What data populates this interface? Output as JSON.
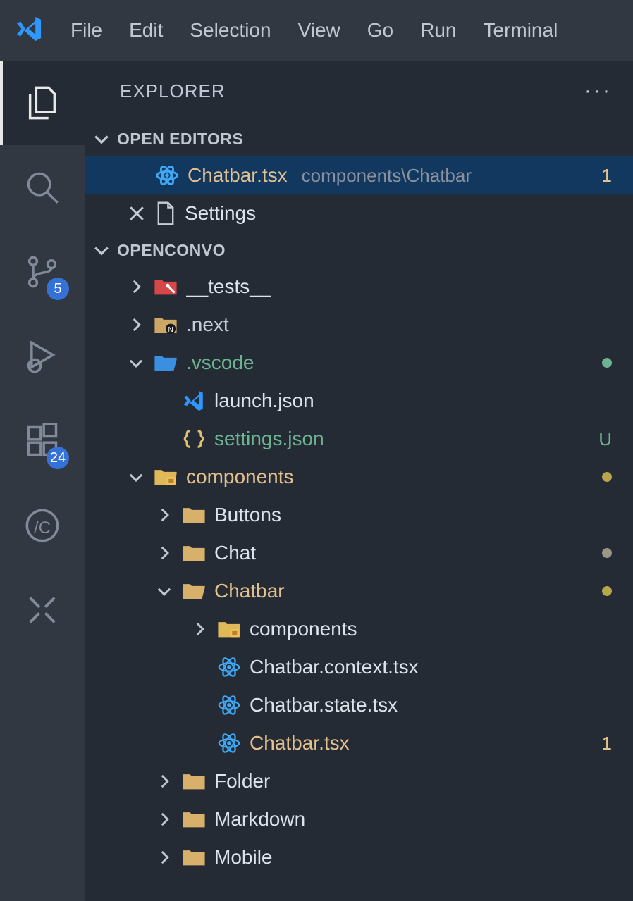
{
  "menubar": {
    "items": [
      "File",
      "Edit",
      "Selection",
      "View",
      "Go",
      "Run",
      "Terminal"
    ]
  },
  "activitybar": {
    "items": [
      {
        "name": "explorer",
        "badge": null,
        "active": true
      },
      {
        "name": "search",
        "badge": null,
        "active": false
      },
      {
        "name": "source-control",
        "badge": "5",
        "active": false
      },
      {
        "name": "run-debug",
        "badge": null,
        "active": false
      },
      {
        "name": "extensions",
        "badge": "24",
        "active": false
      },
      {
        "name": "codeium",
        "badge": null,
        "active": false
      },
      {
        "name": "copilot",
        "badge": null,
        "active": false
      }
    ]
  },
  "sidebar": {
    "title": "EXPLORER",
    "sections": {
      "open_editors": {
        "title": "OPEN EDITORS",
        "items": [
          {
            "name": "Chatbar.tsx",
            "path": "components\\Chatbar",
            "modified": true,
            "problems": "1",
            "icon": "react"
          },
          {
            "name": "Settings",
            "path": "",
            "modified": false,
            "icon": "file",
            "close": true
          }
        ]
      },
      "workspace": {
        "title": "OPENCONVO",
        "tree": [
          {
            "depth": 1,
            "type": "folder-red",
            "name": "__tests__",
            "expanded": false,
            "color": "white"
          },
          {
            "depth": 1,
            "type": "folder-next",
            "name": ".next",
            "expanded": false,
            "color": "grey"
          },
          {
            "depth": 1,
            "type": "folder-blue",
            "name": ".vscode",
            "expanded": true,
            "color": "green",
            "status_dot": "teal"
          },
          {
            "depth": 2,
            "type": "file-vscode",
            "name": "launch.json",
            "color": "white"
          },
          {
            "depth": 2,
            "type": "file-braces",
            "name": "settings.json",
            "color": "green",
            "trail": "U",
            "trail_color": "green"
          },
          {
            "depth": 1,
            "type": "folder-comp",
            "name": "components",
            "expanded": true,
            "color": "yellow",
            "status_dot": "olive"
          },
          {
            "depth": 2,
            "type": "folder",
            "name": "Buttons",
            "expanded": false,
            "color": "white"
          },
          {
            "depth": 2,
            "type": "folder",
            "name": "Chat",
            "expanded": false,
            "color": "white",
            "status_dot": "grey"
          },
          {
            "depth": 2,
            "type": "folder-open",
            "name": "Chatbar",
            "expanded": true,
            "color": "yellow",
            "status_dot": "olive"
          },
          {
            "depth": 3,
            "type": "folder-comp",
            "name": "components",
            "expanded": false,
            "color": "white"
          },
          {
            "depth": 3,
            "type": "file-react",
            "name": "Chatbar.context.tsx",
            "color": "white"
          },
          {
            "depth": 3,
            "type": "file-react",
            "name": "Chatbar.state.tsx",
            "color": "white"
          },
          {
            "depth": 3,
            "type": "file-react",
            "name": "Chatbar.tsx",
            "color": "yellow",
            "trail": "1",
            "trail_color": "yellow"
          },
          {
            "depth": 2,
            "type": "folder",
            "name": "Folder",
            "expanded": false,
            "color": "white"
          },
          {
            "depth": 2,
            "type": "folder",
            "name": "Markdown",
            "expanded": false,
            "color": "white"
          },
          {
            "depth": 2,
            "type": "folder",
            "name": "Mobile",
            "expanded": false,
            "color": "white"
          }
        ]
      }
    }
  }
}
